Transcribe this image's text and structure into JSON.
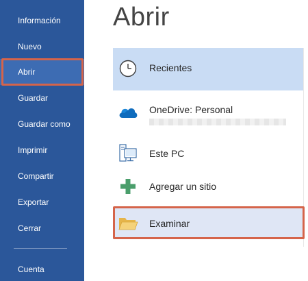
{
  "sidebar": {
    "items": [
      {
        "label": "Información"
      },
      {
        "label": "Nuevo"
      },
      {
        "label": "Abrir",
        "active": true
      },
      {
        "label": "Guardar"
      },
      {
        "label": "Guardar como"
      },
      {
        "label": "Imprimir"
      },
      {
        "label": "Compartir"
      },
      {
        "label": "Exportar"
      },
      {
        "label": "Cerrar"
      }
    ],
    "footer_item": {
      "label": "Cuenta"
    }
  },
  "main": {
    "title": "Abrir",
    "locations": [
      {
        "label": "Recientes",
        "icon": "clock-icon",
        "selected": true
      },
      {
        "label": "OneDrive: Personal",
        "icon": "cloud-icon"
      },
      {
        "label": "Este PC",
        "icon": "computer-icon"
      },
      {
        "label": "Agregar un sitio",
        "icon": "plus-icon"
      },
      {
        "label": "Examinar",
        "icon": "folder-icon",
        "highlighted": true
      }
    ]
  },
  "colors": {
    "sidebar_bg": "#2b579a",
    "sidebar_active": "#3d6cb3",
    "selected_bg": "#c9dcf4",
    "highlight_outline": "#d5644a"
  }
}
